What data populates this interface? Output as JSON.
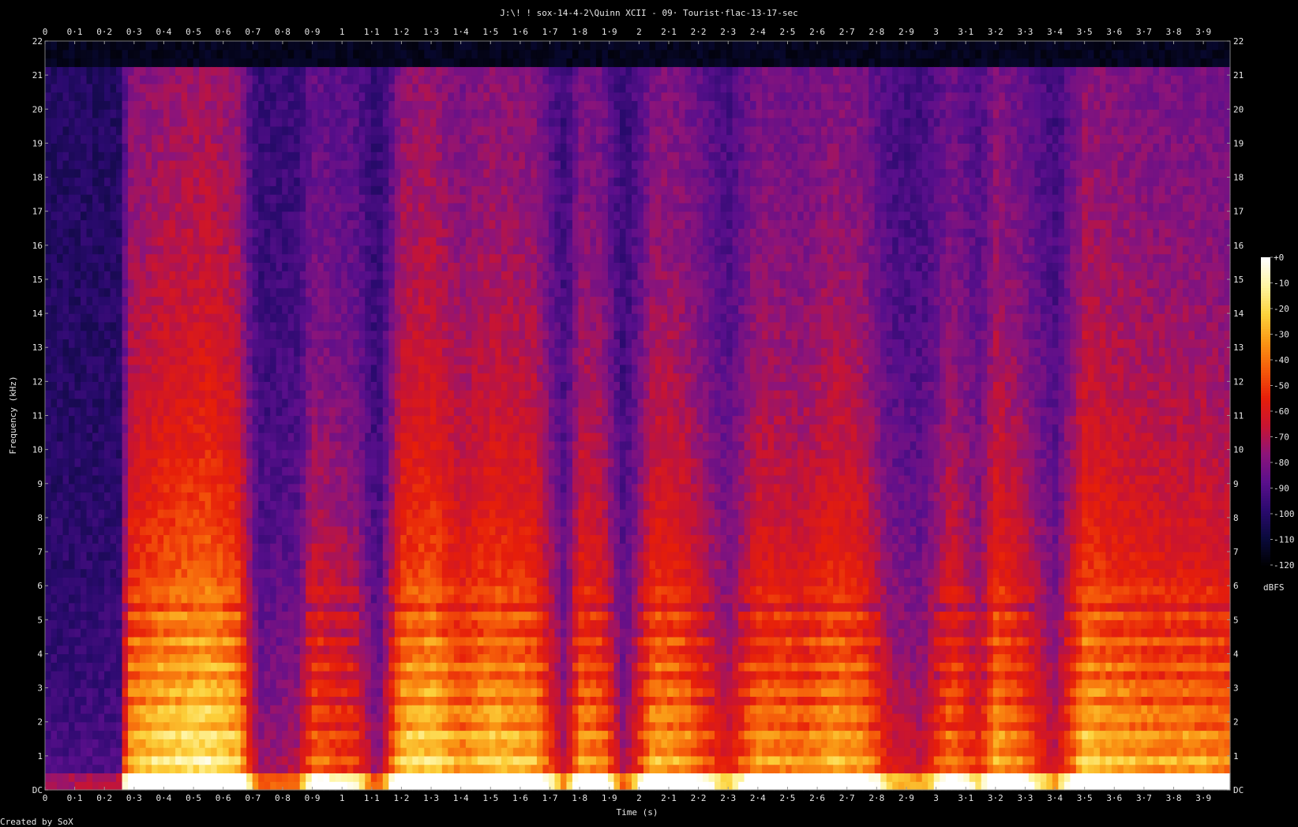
{
  "title": "J:\\! ! sox-14-4-2\\Quinn XCII - 09· Tourist·flac-13-17-sec",
  "footer": "Created by SoX",
  "chart_data": {
    "type": "heatmap",
    "subtype": "spectrogram",
    "title": "J:\\! ! sox-14-4-2\\Quinn XCII - 09· Tourist·flac-13-17-sec",
    "xlabel": "Time (s)",
    "ylabel": "Frequency (kHz)",
    "xlim": [
      0,
      3.99
    ],
    "ylim": [
      0,
      22
    ],
    "x_ticks": [
      0,
      0.1,
      0.2,
      0.3,
      0.4,
      0.5,
      0.6,
      0.7,
      0.8,
      0.9,
      1,
      1.1,
      1.2,
      1.3,
      1.4,
      1.5,
      1.6,
      1.7,
      1.8,
      1.9,
      2,
      2.1,
      2.2,
      2.3,
      2.4,
      2.5,
      2.6,
      2.7,
      2.8,
      2.9,
      3,
      3.1,
      3.2,
      3.3,
      3.4,
      3.5,
      3.6,
      3.7,
      3.8,
      3.9
    ],
    "x_tick_labels": [
      "0",
      "0·1",
      "0·2",
      "0·3",
      "0·4",
      "0·5",
      "0·6",
      "0·7",
      "0·8",
      "0·9",
      "1",
      "1·1",
      "1·2",
      "1·3",
      "1·4",
      "1·5",
      "1·6",
      "1·7",
      "1·8",
      "1·9",
      "2",
      "2·1",
      "2·2",
      "2·3",
      "2·4",
      "2·5",
      "2·6",
      "2·7",
      "2·8",
      "2·9",
      "3",
      "3·1",
      "3·2",
      "3·3",
      "3·4",
      "3·5",
      "3·6",
      "3·7",
      "3·8",
      "3·9"
    ],
    "y_ticks": [
      0,
      1,
      2,
      3,
      4,
      5,
      6,
      7,
      8,
      9,
      10,
      11,
      12,
      13,
      14,
      15,
      16,
      17,
      18,
      19,
      20,
      21,
      22
    ],
    "y_tick_labels": [
      "DC",
      "1",
      "2",
      "3",
      "4",
      "5",
      "6",
      "7",
      "8",
      "9",
      "10",
      "11",
      "12",
      "13",
      "14",
      "15",
      "16",
      "17",
      "18",
      "19",
      "20",
      "21",
      "22"
    ],
    "colorbar": {
      "label": "dBFS",
      "range": [
        -120,
        0
      ],
      "ticks": [
        0,
        -10,
        -20,
        -30,
        -40,
        -50,
        -60,
        -70,
        -80,
        -90,
        -100,
        -110,
        -120
      ],
      "tick_labels": [
        "+0",
        "-10",
        "-20",
        "-30",
        "-40",
        "-50",
        "-60",
        "-70",
        "-80",
        "-90",
        "-100",
        "-110",
        "-120"
      ],
      "colormap": [
        "#000000",
        "#0a0a3c",
        "#2a0a6e",
        "#5a0f8c",
        "#8c147a",
        "#c81432",
        "#e61e0a",
        "#f55a0a",
        "#fa9614",
        "#fcd23c",
        "#fff5a0",
        "#ffffff"
      ]
    },
    "energy_envelope": {
      "t": [
        0.0,
        0.25,
        0.28,
        0.4,
        0.55,
        0.65,
        0.72,
        0.85,
        0.9,
        1.05,
        1.12,
        1.2,
        1.3,
        1.4,
        1.5,
        1.65,
        1.75,
        1.8,
        1.88,
        1.95,
        2.05,
        2.15,
        2.3,
        2.4,
        2.55,
        2.65,
        2.75,
        2.85,
        2.95,
        3.05,
        3.15,
        3.2,
        3.3,
        3.4,
        3.5,
        3.6,
        3.75,
        3.9,
        3.99
      ],
      "level": [
        0.15,
        0.18,
        0.85,
        0.95,
        1.0,
        0.9,
        0.35,
        0.4,
        0.7,
        0.6,
        0.3,
        0.9,
        0.95,
        0.8,
        0.9,
        0.85,
        0.4,
        0.8,
        0.75,
        0.35,
        0.85,
        0.8,
        0.5,
        0.8,
        0.75,
        0.85,
        0.8,
        0.5,
        0.45,
        0.75,
        0.55,
        0.85,
        0.7,
        0.45,
        0.9,
        0.85,
        0.8,
        0.8,
        0.75
      ]
    }
  }
}
